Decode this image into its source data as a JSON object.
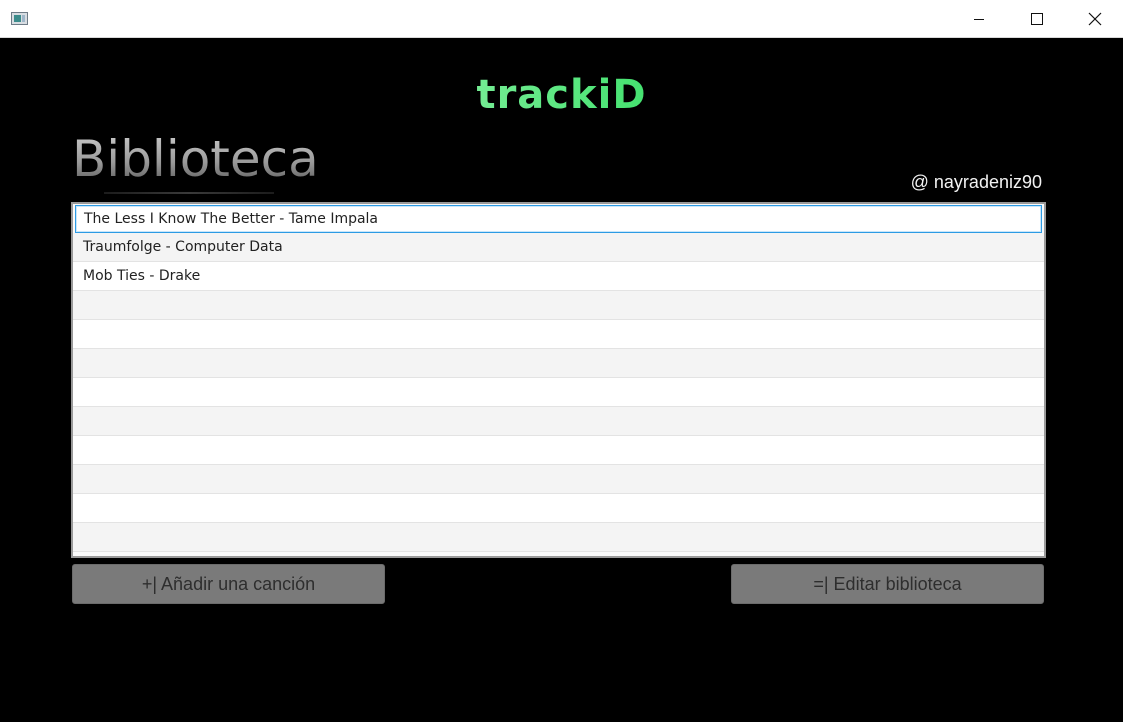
{
  "window": {
    "icons": {
      "app": "app-window-icon",
      "minimize": "minimize-icon",
      "maximize": "maximize-icon",
      "close": "close-icon"
    }
  },
  "app": {
    "logo": "trackiD",
    "section_title": "Biblioteca",
    "username": "@ nayradeniz90"
  },
  "library": {
    "songs": [
      "The Less I Know The Better - Tame Impala",
      "Traumfolge - Computer Data",
      "Mob Ties - Drake"
    ],
    "selected_index": 0
  },
  "buttons": {
    "add_song": "+| Añadir una canción",
    "edit_library": "=| Editar biblioteca"
  },
  "colors": {
    "logo_accent": "#3de06a",
    "selection_border": "#2c9be4",
    "button_bg": "#7a7a7a"
  }
}
